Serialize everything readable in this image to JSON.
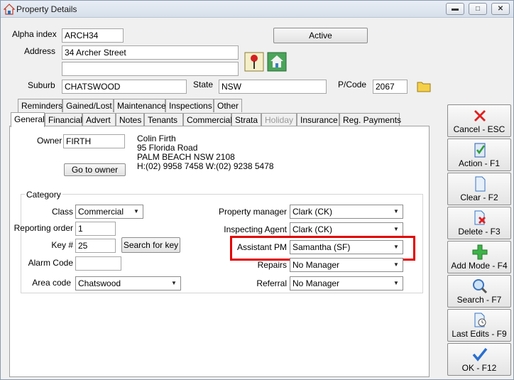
{
  "window": {
    "title": "Property Details"
  },
  "header": {
    "alpha_index_label": "Alpha index",
    "alpha_index_value": "ARCH34",
    "active_button": "Active",
    "address_label": "Address",
    "address_line1": "34 Archer Street",
    "address_line2": "",
    "suburb_label": "Suburb",
    "suburb_value": "CHATSWOOD",
    "state_label": "State",
    "state_value": "NSW",
    "postcode_label": "P/Code",
    "postcode_value": "2067"
  },
  "tabs_row1": [
    "Reminders",
    "Gained/Lost",
    "Maintenance",
    "Inspections",
    "Other"
  ],
  "tabs_row2": [
    "General",
    "Financial",
    "Advert",
    "Notes",
    "Tenants",
    "Commercial",
    "Strata",
    "Holiday",
    "Insurance",
    "Reg. Payments"
  ],
  "owner": {
    "label": "Owner",
    "code": "FIRTH",
    "name": "Colin Firth",
    "street": "95 Florida Road",
    "city": "PALM BEACH NSW 2108",
    "phones": "H:(02) 9958 7458  W:(02) 9238 5478",
    "go_button": "Go to owner"
  },
  "category": {
    "title": "Category",
    "class_label": "Class",
    "class_value": "Commercial",
    "reporting_label": "Reporting order",
    "reporting_value": "1",
    "key_label": "Key #",
    "key_value": "25",
    "search_key_button": "Search for key",
    "alarm_label": "Alarm Code",
    "alarm_value": "",
    "area_label": "Area code",
    "area_value": "Chatswood",
    "pm_label": "Property manager",
    "pm_value": "Clark  (CK)",
    "agent_label": "Inspecting Agent",
    "agent_value": "Clark  (CK)",
    "assistant_label": "Assistant PM",
    "assistant_value": "Samantha  (SF)",
    "repairs_label": "Repairs",
    "repairs_value": "No Manager",
    "referral_label": "Referral",
    "referral_value": "No Manager"
  },
  "side_buttons": [
    "Cancel - ESC",
    "Action - F1",
    "Clear - F2",
    "Delete - F3",
    "Add Mode - F4",
    "Search - F7",
    "Last Edits - F9",
    "OK - F12"
  ]
}
